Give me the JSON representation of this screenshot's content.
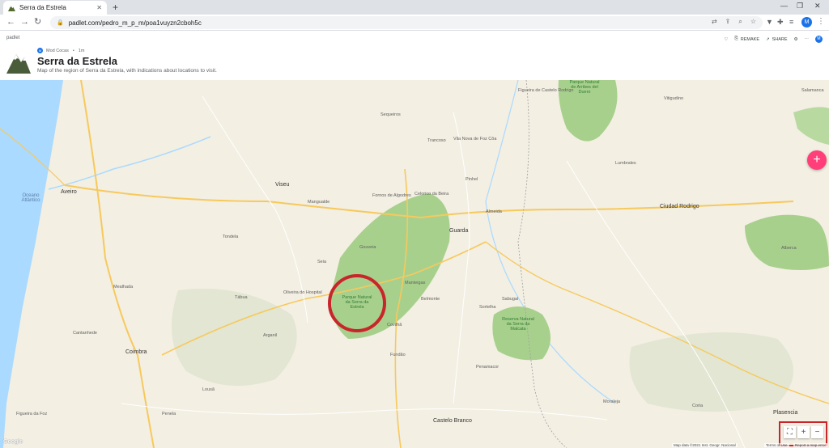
{
  "browser": {
    "tab_title": "Serra da Estrela",
    "url": "padlet.com/pedro_m_p_m/poa1vuyzn2cboh5c",
    "profile_initial": "M"
  },
  "padlet": {
    "brand": "padlet",
    "author_name": "Mod Cocas",
    "author_initial": "M",
    "time": "1m",
    "title": "Serra da Estrela",
    "description": "Map of the region of Serra da Estrela, with indications about locations to visit.",
    "actions": {
      "remake": "REMAKE",
      "share": "SHARE"
    },
    "user_initial": "M",
    "fab_label": "+"
  },
  "map": {
    "colors": {
      "land": "#f3efe3",
      "park": "#a8d08d",
      "sea": "#aadaff",
      "road": "#f7c95c",
      "marker": "#c8262b"
    },
    "park_label": "Parque Natural da Serra da Estrela",
    "places": [
      "Oceano Atlântico",
      "Aveiro",
      "Coimbra",
      "Viseu",
      "Guarda",
      "Covilhã",
      "Seia",
      "Gouveia",
      "Fundão",
      "Castelo Branco",
      "Sabugal",
      "Figueira de Castelo Rodrigo",
      "Vila Nova de Foz Côa",
      "Mealhada",
      "Tondela",
      "Mangualde",
      "Fornos de Algodres",
      "Celorico da Beira",
      "Trancoso",
      "Manteigas",
      "Belmonte",
      "Penamacor",
      "Oliveira do Hospital",
      "Tábua",
      "Lousã",
      "Arganil",
      "Penela",
      "Cantanhede",
      "Figueira da Foz",
      "Ciudad Rodrigo",
      "Vitigudino",
      "Lumbrales",
      "Plasencia",
      "Coria",
      "Moraleja",
      "Alberca",
      "Salamanca",
      "Sequeiros",
      "Almeida",
      "Pinhel",
      "Sortelha"
    ],
    "park_labels": [
      "Parque Natural de Arribes del Duero",
      "Reserva Natural da Serra da Malcata"
    ],
    "zoom_in": "+",
    "zoom_out": "−",
    "attribution": "Map data ©2021 Inst. Geogr. Nacional",
    "terms": "Terms of Use",
    "report": "Report a map error",
    "google": "Google"
  }
}
